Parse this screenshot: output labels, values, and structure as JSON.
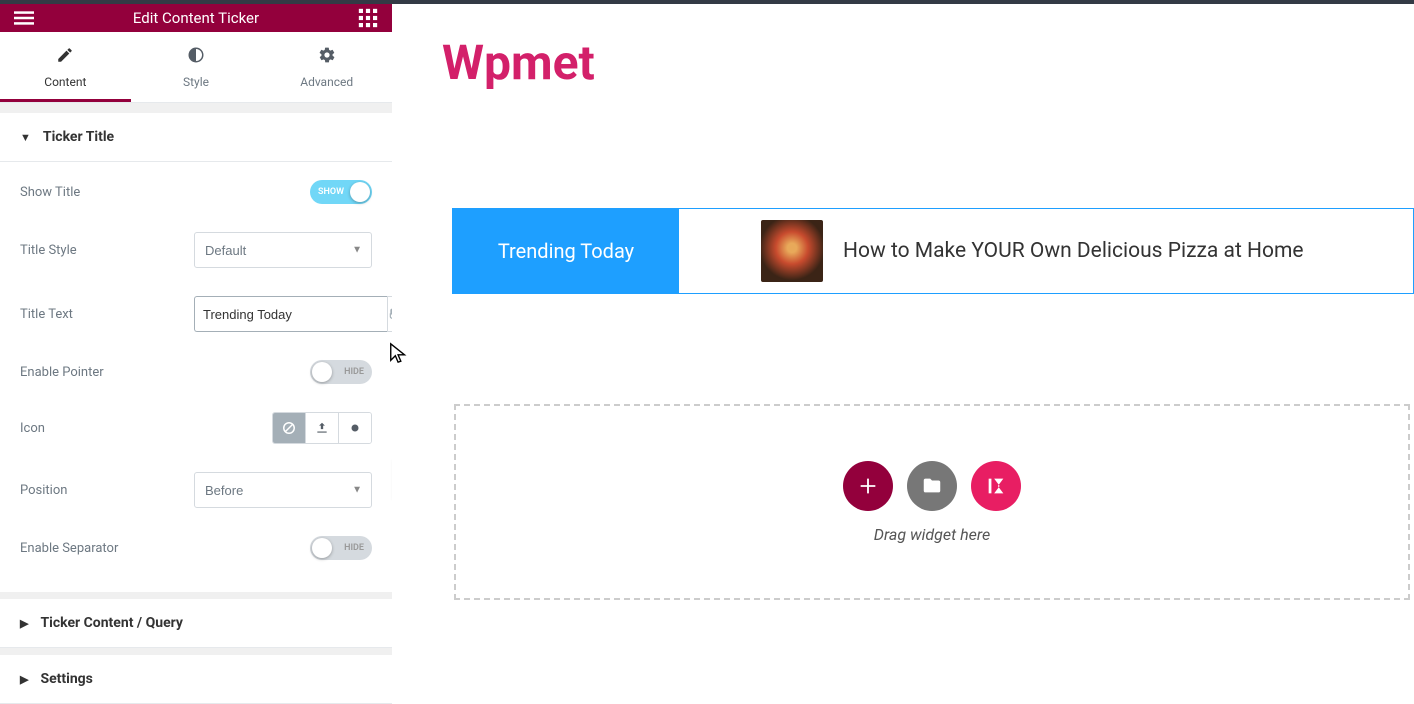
{
  "header": {
    "title": "Edit Content Ticker"
  },
  "tabs": {
    "content": "Content",
    "style": "Style",
    "advanced": "Advanced"
  },
  "sections": {
    "ticker_title": {
      "label": "Ticker Title",
      "show_title": {
        "label": "Show Title",
        "state": "SHOW"
      },
      "title_style": {
        "label": "Title Style",
        "value": "Default"
      },
      "title_text": {
        "label": "Title Text",
        "value": "Trending Today"
      },
      "enable_pointer": {
        "label": "Enable Pointer",
        "state": "HIDE"
      },
      "icon": {
        "label": "Icon"
      },
      "position": {
        "label": "Position",
        "value": "Before"
      },
      "enable_separator": {
        "label": "Enable Separator",
        "state": "HIDE"
      }
    },
    "ticker_content": {
      "label": "Ticker Content / Query"
    },
    "settings": {
      "label": "Settings"
    }
  },
  "preview": {
    "logo": "Wpmet",
    "ticker_title": "Trending Today",
    "ticker_item": "How to Make YOUR Own Delicious Pizza at Home",
    "dropzone_text": "Drag widget here"
  }
}
